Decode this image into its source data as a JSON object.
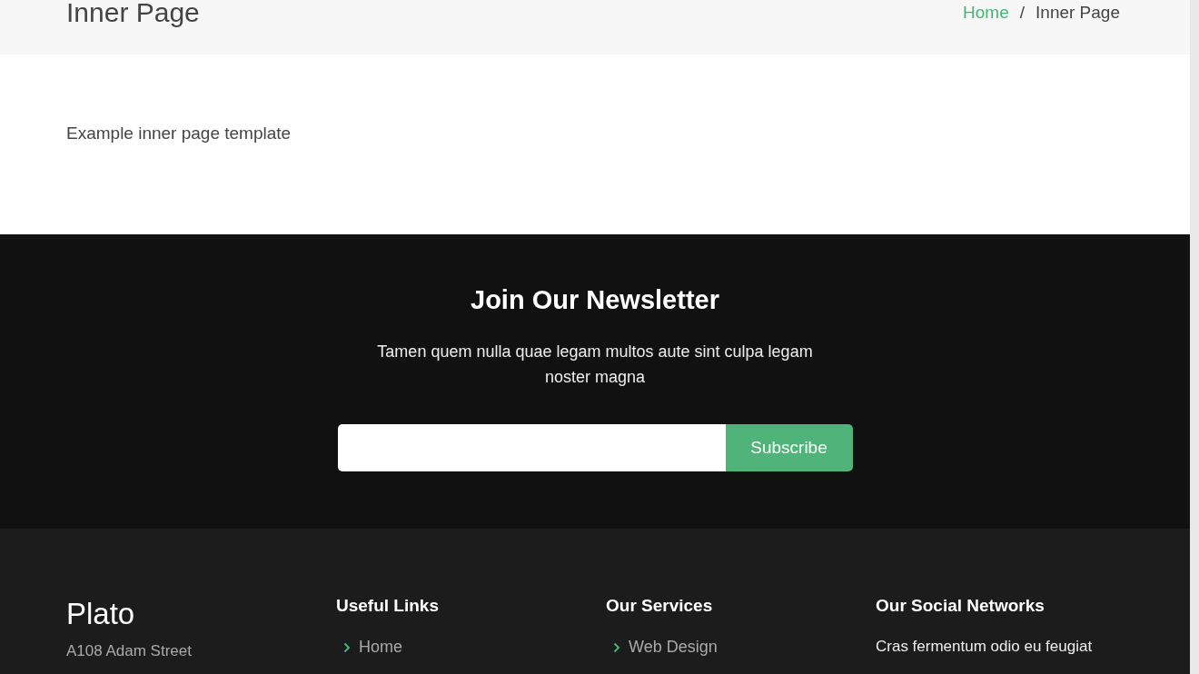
{
  "page_header": {
    "title": "Inner Page",
    "separator": "/",
    "breadcrumbs": [
      {
        "label": "Home",
        "kind": "link"
      },
      {
        "label": "Inner Page",
        "kind": "current"
      }
    ]
  },
  "content": {
    "text": "Example inner page template"
  },
  "newsletter": {
    "title": "Join Our Newsletter",
    "text": "Tamen quem nulla quae legam multos aute sint culpa legam noster magna",
    "button": "Subscribe"
  },
  "footer": {
    "brand": "Plato",
    "address": "A108 Adam Street",
    "columns": [
      {
        "title": "Useful Links",
        "links": [
          "Home"
        ]
      },
      {
        "title": "Our Services",
        "links": [
          "Web Design"
        ]
      },
      {
        "title": "Our Social Networks",
        "text": "Cras fermentum odio eu feugiat"
      }
    ]
  }
}
